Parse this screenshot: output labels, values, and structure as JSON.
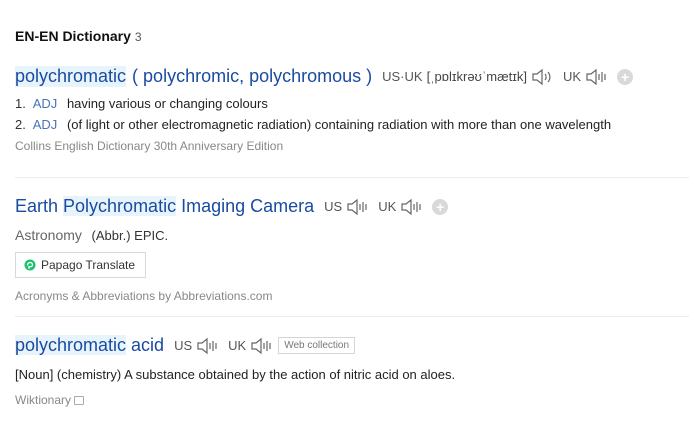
{
  "header": {
    "title": "EN-EN Dictionary",
    "count": "3"
  },
  "entries": [
    {
      "headword": "polychromatic",
      "variants": "( polychromic, polychromous )",
      "pron_us_uk_label": "US·UK",
      "ipa": "[ˌpɒlɪkrəʊˈmætɪk]",
      "pron_uk_label": "UK",
      "definitions": [
        {
          "num": "1.",
          "pos": "ADJ",
          "text": "having various or changing colours"
        },
        {
          "num": "2.",
          "pos": "ADJ",
          "text": "(of light or other electromagnetic radiation) containing radiation with more than one wavelength"
        }
      ],
      "source": "Collins English Dictionary 30th Anniversary Edition"
    },
    {
      "headword_pre": "Earth ",
      "headword_hl": "Polychromatic",
      "headword_post": " Imaging Camera",
      "pron_us_label": "US",
      "pron_uk_label": "UK",
      "subject": "Astronomy",
      "definition": "(Abbr.) EPIC.",
      "papago_label": "Papago Translate",
      "source": "Acronyms & Abbreviations by Abbreviations.com"
    },
    {
      "headword_hl": "polychromatic",
      "headword_post": " acid",
      "pron_us_label": "US",
      "pron_uk_label": "UK",
      "tag": "Web collection",
      "definition": "[Noun] (chemistry) A substance obtained by the action of nitric acid on aloes.",
      "source": "Wiktionary"
    }
  ],
  "colors": {
    "link": "#1a4ba3",
    "highlight": "#e8f4fb",
    "pos": "#4a73b5",
    "muted": "#888888",
    "papago_green": "#1ec06e"
  },
  "icons": [
    "speaker-icon",
    "add-icon",
    "papago-icon",
    "external-link-icon"
  ]
}
